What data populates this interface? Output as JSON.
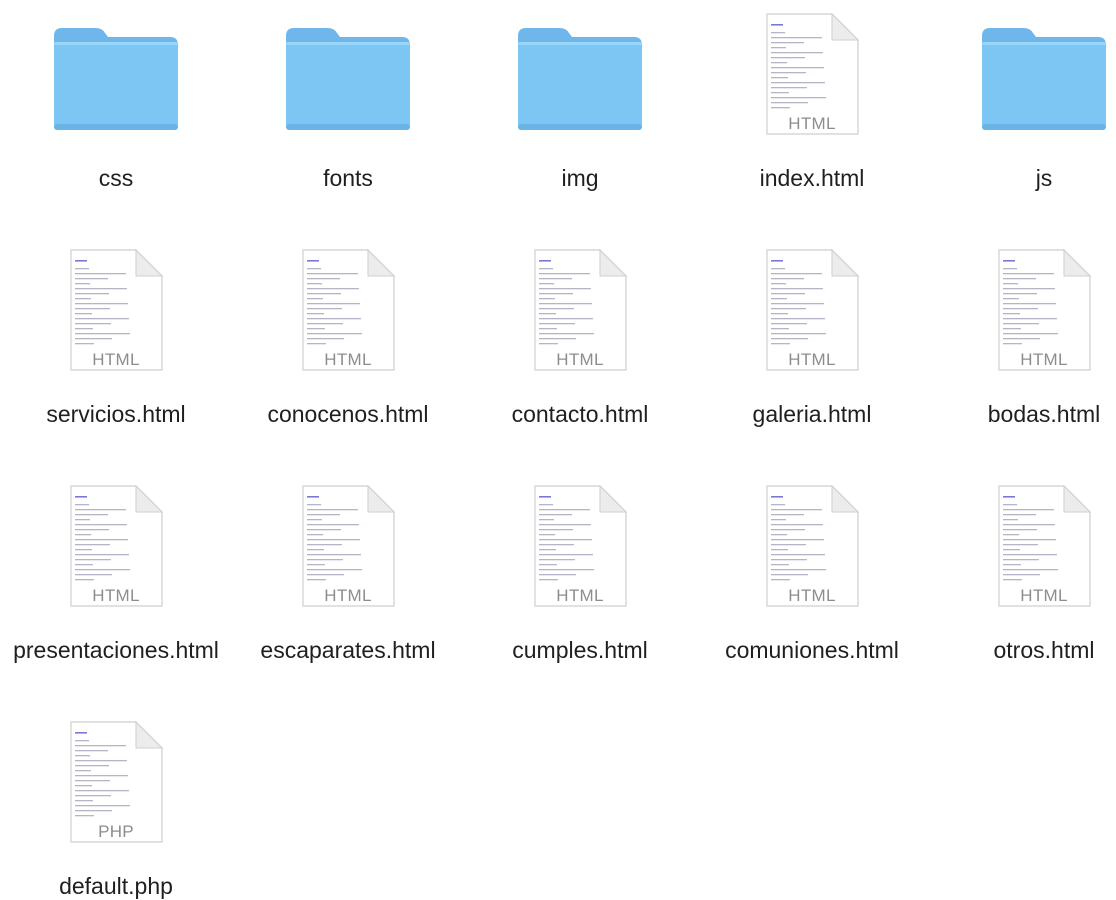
{
  "window": {
    "view": "icon-view"
  },
  "colors": {
    "folder_body": "#7cc6f4",
    "folder_tab": "#6fb7ea",
    "doc_border": "#cfcfcf",
    "label_text": "#1f1f1f",
    "kind_text": "#8d8d8d"
  },
  "items": [
    {
      "name": "css",
      "type": "folder",
      "icon": "folder-icon"
    },
    {
      "name": "fonts",
      "type": "folder",
      "icon": "folder-icon"
    },
    {
      "name": "img",
      "type": "folder",
      "icon": "folder-icon"
    },
    {
      "name": "index.html",
      "type": "document",
      "kind_label": "HTML",
      "icon": "html-document-icon"
    },
    {
      "name": "js",
      "type": "folder",
      "icon": "folder-icon"
    },
    {
      "name": "servicios.html",
      "type": "document",
      "kind_label": "HTML",
      "icon": "html-document-icon"
    },
    {
      "name": "conocenos.html",
      "type": "document",
      "kind_label": "HTML",
      "icon": "html-document-icon"
    },
    {
      "name": "contacto.html",
      "type": "document",
      "kind_label": "HTML",
      "icon": "html-document-icon"
    },
    {
      "name": "galeria.html",
      "type": "document",
      "kind_label": "HTML",
      "icon": "html-document-icon"
    },
    {
      "name": "bodas.html",
      "type": "document",
      "kind_label": "HTML",
      "icon": "html-document-icon"
    },
    {
      "name": "presentaciones.html",
      "type": "document",
      "kind_label": "HTML",
      "icon": "html-document-icon"
    },
    {
      "name": "escaparates.html",
      "type": "document",
      "kind_label": "HTML",
      "icon": "html-document-icon"
    },
    {
      "name": "cumples.html",
      "type": "document",
      "kind_label": "HTML",
      "icon": "html-document-icon"
    },
    {
      "name": "comuniones.html",
      "type": "document",
      "kind_label": "HTML",
      "icon": "html-document-icon"
    },
    {
      "name": "otros.html",
      "type": "document",
      "kind_label": "HTML",
      "icon": "html-document-icon"
    },
    {
      "name": "default.php",
      "type": "document",
      "kind_label": "PHP",
      "icon": "php-document-icon"
    }
  ]
}
